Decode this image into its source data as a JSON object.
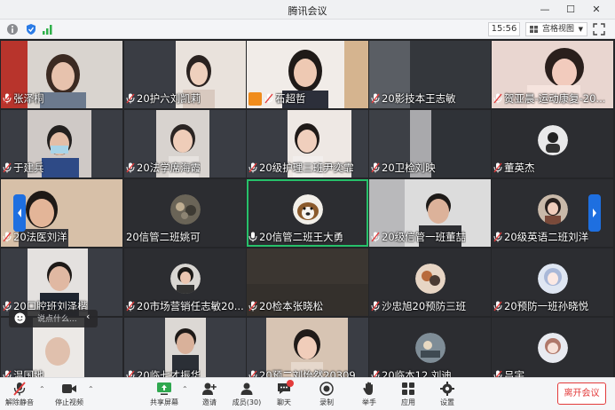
{
  "window": {
    "title": "腾讯会议"
  },
  "infobar": {
    "time": "15:56",
    "view_label": "宫格视图"
  },
  "participants": [
    "张泽桐",
    "20护六刘凯莉",
    "石超哲",
    "20影技本王志敏",
    "贺亚晨-运动康复-20...",
    "于建兵",
    "20法学席海霞",
    "20级护理三班尹奕霏",
    "20卫检刘映",
    "董英杰",
    "20法医刘洋",
    "20信管二班姚可",
    "20信管二班王大勇",
    "20级信管一班董喆",
    "20级英语二班刘洋",
    "20口腔班刘泽楷",
    "20市场营销任志敏20...",
    "20检本张晓松",
    "沙忠旭20预防三班",
    "20预防一班孙晓悦",
    "温国地",
    "20临七才振华",
    "20预二刘怡然20309",
    "20临本12 刘迪",
    "吕宇"
  ],
  "chat_popup": {
    "placeholder": "说点什么..."
  },
  "toolbar": {
    "unmute": "解除静音",
    "stop_video": "停止视频",
    "share": "共享屏幕",
    "invite": "邀请",
    "members": "成员(30)",
    "chat": "聊天",
    "record": "录制",
    "raise_hand": "举手",
    "apps": "应用",
    "settings": "设置",
    "leave": "离开会议"
  },
  "colors": {
    "accent": "#1e6fe0",
    "active_speaker": "#27c06a",
    "leave": "#e33b3b",
    "host": "#f08c1c"
  }
}
